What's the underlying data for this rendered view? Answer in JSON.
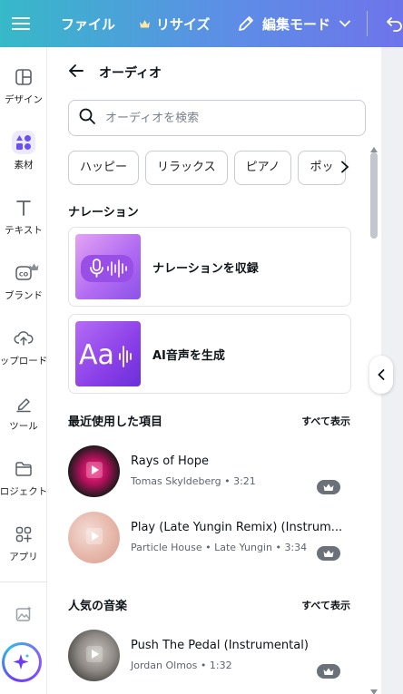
{
  "topbar": {
    "menu_icon": "hamburger-icon",
    "file_label": "ファイル",
    "resize_label": "リサイズ",
    "edit_mode_label": "編集モード"
  },
  "rail": {
    "items": [
      {
        "label": "デザイン",
        "icon": "design-layout-icon"
      },
      {
        "label": "素材",
        "icon": "elements-shapes-icon"
      },
      {
        "label": "テキスト",
        "icon": "text-t-icon"
      },
      {
        "label": "ブランド",
        "icon": "brand-icon"
      },
      {
        "label": "ップロード",
        "icon": "upload-cloud-icon"
      },
      {
        "label": "ツール",
        "icon": "pen-tool-icon"
      },
      {
        "label": "ロジェクト",
        "icon": "folder-icon"
      },
      {
        "label": "アプリ",
        "icon": "apps-grid-icon"
      }
    ]
  },
  "panel": {
    "title": "オーディオ",
    "search_placeholder": "オーディオを検索",
    "chips": [
      "ハッピー",
      "リラックス",
      "ピアノ",
      "ポッ"
    ],
    "narration": {
      "section_title": "ナレーション",
      "record_label": "ナレーションを収録",
      "ai_label": "AI音声を生成",
      "ai_thumb_text": "Aa"
    },
    "recent": {
      "section_title": "最近使用した項目",
      "see_all": "すべて表示",
      "tracks": [
        {
          "title": "Rays of Hope",
          "artist": "Tomas Skyldeberg",
          "duration": "3:21"
        },
        {
          "title": "Play (Late Yungin Remix) (Instrum...",
          "artist": "Particle House • Late Yungin",
          "duration": "3:34"
        }
      ]
    },
    "popular": {
      "section_title": "人気の音楽",
      "see_all": "すべて表示",
      "tracks": [
        {
          "title": "Push The Pedal (Instrumental)",
          "artist": "Jordan Olmos",
          "duration": "1:32"
        }
      ]
    }
  },
  "colors": {
    "accent": "#6a4ff5",
    "topbar_start": "#36b9c8",
    "topbar_end": "#6e74ea",
    "crown_badge": "#6b7079"
  }
}
